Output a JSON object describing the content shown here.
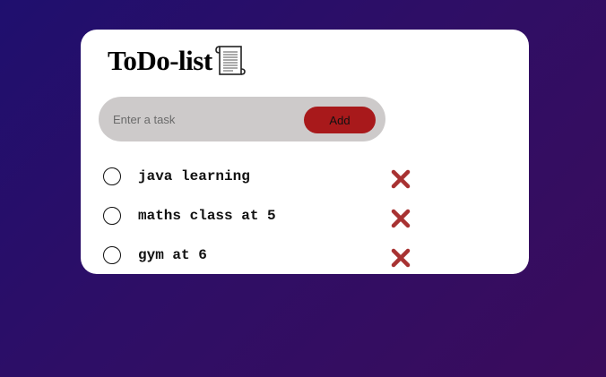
{
  "app": {
    "title": "ToDo-list",
    "title_icon": "scroll-icon"
  },
  "input": {
    "placeholder": "Enter a task",
    "value": "",
    "add_label": "Add"
  },
  "tasks": [
    {
      "text": "java learning",
      "checked": false
    },
    {
      "text": "maths class at 5",
      "checked": false
    },
    {
      "text": "gym at 6",
      "checked": false
    }
  ],
  "icons": {
    "check": "empty-circle-icon",
    "delete": "close-x-icon"
  },
  "colors": {
    "bg_start": "#1f0f6e",
    "bg_end": "#3a0c5c",
    "card": "#ffffff",
    "input_bar": "#cdcaca",
    "add_button": "#a8191b",
    "delete_x": "#a83232"
  }
}
